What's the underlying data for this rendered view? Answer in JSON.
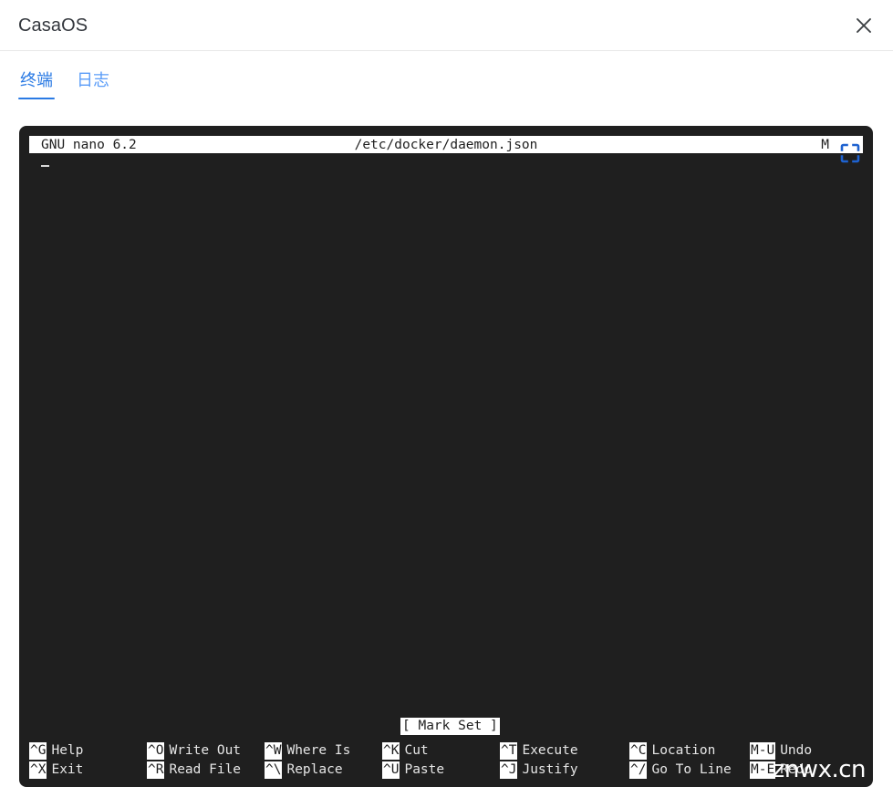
{
  "header": {
    "app_title": "CasaOS",
    "close_icon": "close-icon"
  },
  "tabs": [
    {
      "label": "终端",
      "active": true
    },
    {
      "label": "日志",
      "active": false
    }
  ],
  "terminal": {
    "fullscreen_icon": "fullscreen-icon",
    "background_color": "#1f1f1f",
    "nano": {
      "version": "GNU nano 6.2",
      "filename": "/etc/docker/daemon.json",
      "modified_flag": "M",
      "status_message": "[ Mark Set ]",
      "cursor": "_",
      "shortcut_columns": [
        {
          "rows": [
            {
              "key": "^G",
              "label": "Help"
            },
            {
              "key": "^X",
              "label": "Exit"
            }
          ]
        },
        {
          "rows": [
            {
              "key": "^O",
              "label": "Write Out"
            },
            {
              "key": "^R",
              "label": "Read File"
            }
          ]
        },
        {
          "rows": [
            {
              "key": "^W",
              "label": "Where Is"
            },
            {
              "key": "^\\",
              "label": "Replace"
            }
          ]
        },
        {
          "rows": [
            {
              "key": "^K",
              "label": "Cut"
            },
            {
              "key": "^U",
              "label": "Paste"
            }
          ]
        },
        {
          "rows": [
            {
              "key": "^T",
              "label": "Execute"
            },
            {
              "key": "^J",
              "label": "Justify"
            }
          ]
        },
        {
          "rows": [
            {
              "key": "^C",
              "label": "Location"
            },
            {
              "key": "^/",
              "label": "Go To Line"
            }
          ]
        },
        {
          "rows": [
            {
              "key": "M-U",
              "label": "Undo"
            },
            {
              "key": "M-E",
              "label": "Redo"
            }
          ]
        }
      ]
    }
  },
  "watermark": {
    "text": "znwx.cn"
  },
  "colors": {
    "accent": "#2a7ae4",
    "tab_inactive": "#5a9cf8",
    "terminal_bg": "#1f1f1f",
    "terminal_fg": "#e6e6e6",
    "header_border": "#e8e8e8"
  }
}
